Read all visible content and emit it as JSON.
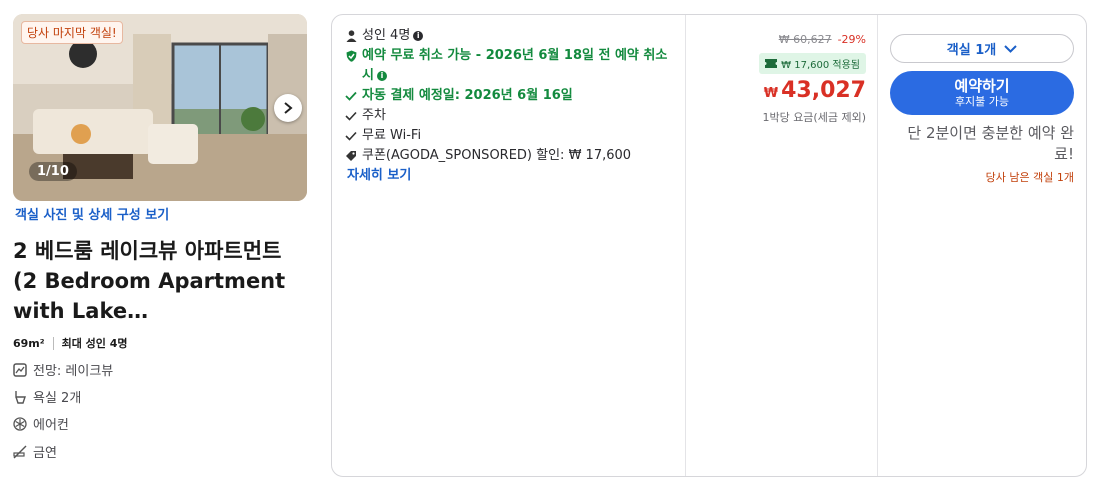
{
  "left": {
    "badge": "당사 마지막 객실!",
    "photo_counter": "1/10",
    "photos_link": "객실 사진 및 상세 구성 보기",
    "room_title": "2 베드룸 레이크뷰 아파트먼트 (2 Bedroom Apartment with Lake…",
    "size": "69m²",
    "max_guests": "최대 성인 4명",
    "features": [
      {
        "icon": "view-icon",
        "label": "전망: 레이크뷰"
      },
      {
        "icon": "bathroom-icon",
        "label": "욕실 2개"
      },
      {
        "icon": "snowflake-icon",
        "label": "에어컨"
      },
      {
        "icon": "no-smoking-icon",
        "label": "금연"
      }
    ]
  },
  "benefits": {
    "guests": "성인 4명",
    "free_cancel": "예약 무료 취소 가능 - 2026년 6월 18일 전 예약 취소 시",
    "auto_payment": "자동 결제 예정일: 2026년 6월 16일",
    "parking": "주차",
    "wifi": "무료 Wi-Fi",
    "coupon": "쿠폰(AGODA_SPONSORED) 할인: ₩ 17,600",
    "details_link": "자세히 보기"
  },
  "price": {
    "original": "₩ 60,627",
    "discount": "-29%",
    "applied": "₩ 17,600 적용됨",
    "currency": "₩",
    "amount": "43,027",
    "note": "1박당 요금(세금 제외)"
  },
  "cta": {
    "room_select": "객실 1개",
    "book_main": "예약하기",
    "book_sub": "후지불 가능",
    "urgency": "단 2분이면 충분한 예약 완료!",
    "rooms_left": "당사 남은 객실 1개"
  },
  "colors": {
    "accent": "#2b6be2",
    "green": "#138a3e",
    "price_red": "#d93025",
    "warning": "#c2410c"
  }
}
